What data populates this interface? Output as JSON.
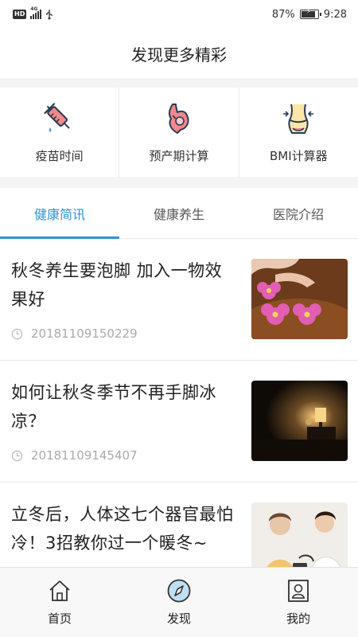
{
  "status_bar": {
    "hd": "HD",
    "network": "4G",
    "battery_percent": "87%",
    "battery_level": 0.87,
    "time": "9:28"
  },
  "header": {
    "title": "发现更多精彩"
  },
  "tools": [
    {
      "label": "疫苗时间",
      "icon": "syringe-icon"
    },
    {
      "label": "预产期计算",
      "icon": "pregnancy-icon"
    },
    {
      "label": "BMI计算器",
      "icon": "waist-measure-icon"
    }
  ],
  "tabs": [
    {
      "label": "健康简讯",
      "active": true
    },
    {
      "label": "健康养生",
      "active": false
    },
    {
      "label": "医院介绍",
      "active": false
    }
  ],
  "articles": [
    {
      "title": "秋冬养生要泡脚 加入一物效果好",
      "time": "20181109150229",
      "thumb": "foot-bath-flowers-image"
    },
    {
      "title": "如何让秋冬季节不再手脚冰凉？",
      "time": "20181109145407",
      "thumb": "bedroom-lamp-image"
    },
    {
      "title": "立冬后，人体这七个器官最怕冷！3招教你过一个暖冬~",
      "time": "",
      "thumb": "doctor-blood-pressure-image"
    }
  ],
  "bottom_nav": [
    {
      "label": "首页",
      "icon": "home-icon",
      "active": false
    },
    {
      "label": "发现",
      "icon": "compass-icon",
      "active": true
    },
    {
      "label": "我的",
      "icon": "profile-icon",
      "active": false
    }
  ],
  "colors": {
    "accent": "#2c94d6",
    "tool_icon_fill": "#f08a8a",
    "tool_icon_stroke": "#2b3a55",
    "clock_icon": "#bbbbbb"
  }
}
